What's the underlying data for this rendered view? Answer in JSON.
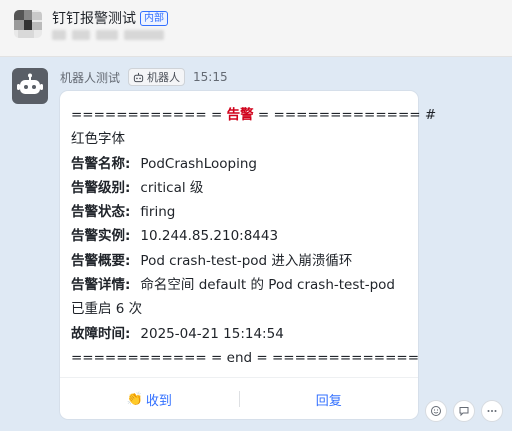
{
  "header": {
    "group_name": "钉钉报警测试",
    "tag": "内部"
  },
  "message": {
    "sender": "机器人测试",
    "badge": "机器人",
    "time": "15:15",
    "lines": {
      "sep_start_a": "============ = ",
      "alarm_word": "告警",
      "sep_start_b": " = ============= #",
      "font_note": "红色字体",
      "name_label": "告警名称:",
      "name_value": "PodCrashLooping",
      "level_label": "告警级别:",
      "level_value": "critical 级",
      "status_label": "告警状态:",
      "status_value": "firing",
      "instance_label": "告警实例:",
      "instance_value": "10.244.85.210:8443",
      "summary_label": "告警概要:",
      "summary_value": "Pod crash-test-pod 进入崩溃循环",
      "detail_label": "告警详情:",
      "detail_value": "命名空间 default 的 Pod crash-test-pod",
      "detail_cont": "已重启 6 次",
      "fault_label": "故障时间:",
      "fault_value": "2025-04-21 15:14:54",
      "sep_end": "============ = end = ============="
    },
    "actions": {
      "received": "收到",
      "reply": "回复"
    }
  },
  "icons": {
    "bot_avatar": "robot-icon",
    "badge_icon": "robot-small-icon",
    "received_icon": "clap-hand-icon",
    "reaction_add": "emoji-add-icon",
    "reaction_comment": "comment-icon",
    "reaction_more": "more-icon"
  },
  "colors": {
    "alarm_red": "#d0021b",
    "link_blue": "#3370ff",
    "chat_bg": "#dfe9f4",
    "header_bg": "#f5f5f5"
  }
}
